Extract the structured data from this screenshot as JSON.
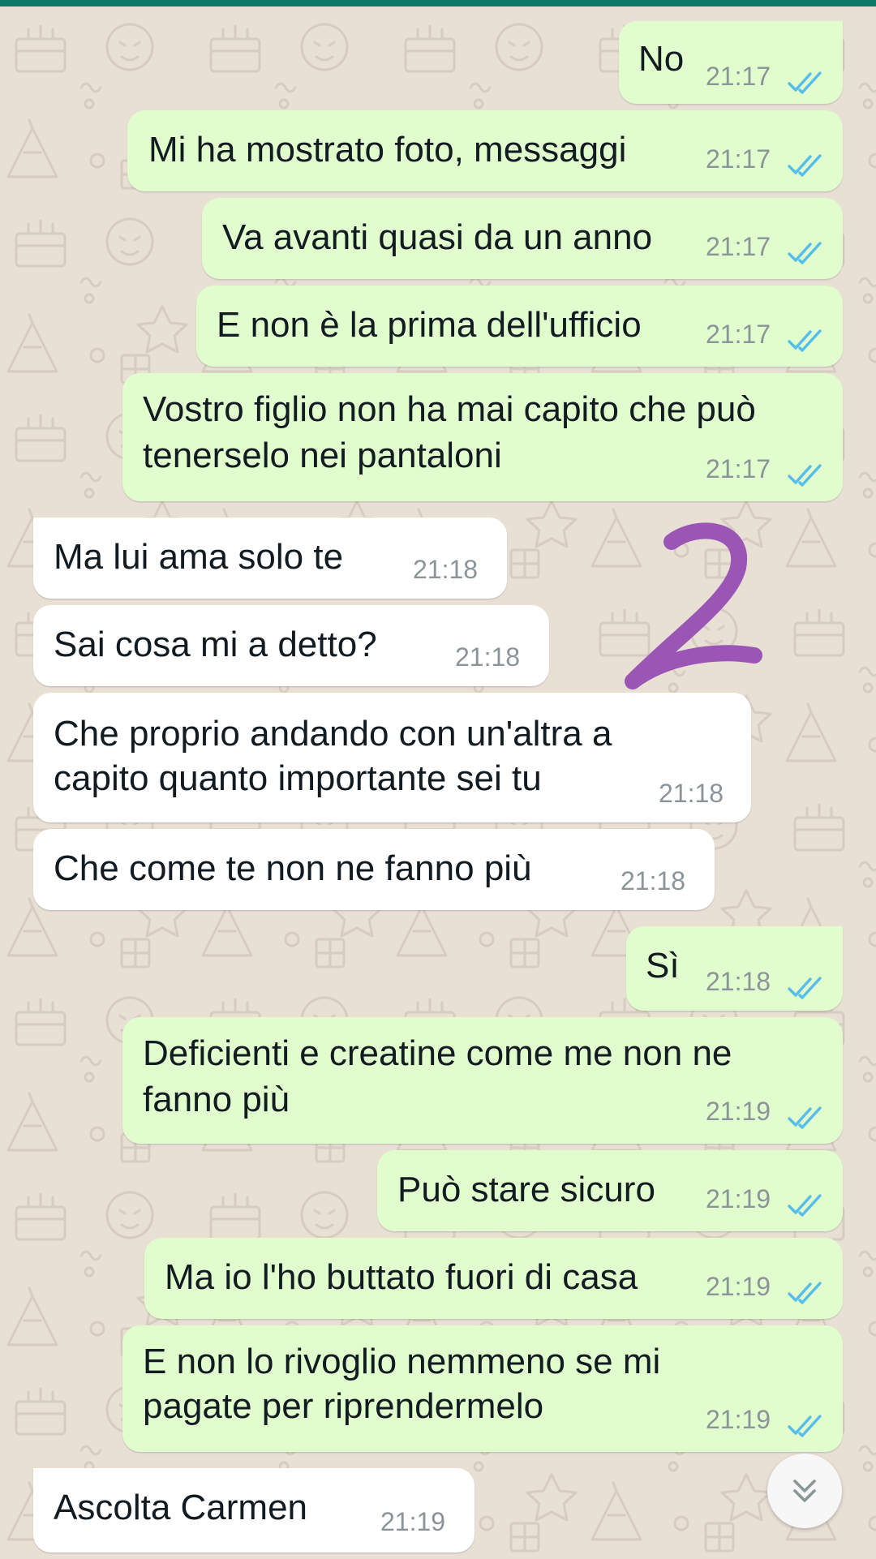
{
  "chat": {
    "messages": [
      {
        "dir": "out",
        "tail": true,
        "text": "No",
        "time": "21:17",
        "status": "read"
      },
      {
        "dir": "out",
        "tail": false,
        "text": "Mi ha mostrato foto, messaggi",
        "time": "21:17",
        "status": "read"
      },
      {
        "dir": "out",
        "tail": false,
        "text": "Va avanti quasi da un anno",
        "time": "21:17",
        "status": "read"
      },
      {
        "dir": "out",
        "tail": false,
        "text": "E non è la prima dell'ufficio",
        "time": "21:17",
        "status": "read"
      },
      {
        "dir": "out",
        "tail": false,
        "lines": [
          "Vostro figlio non ha mai capito che può",
          "tenerselo nei pantaloni"
        ],
        "time": "21:17",
        "status": "read"
      },
      {
        "dir": "in",
        "tail": true,
        "text": "Ma lui ama solo te",
        "time": "21:18"
      },
      {
        "dir": "in",
        "tail": false,
        "text": "Sai cosa mi a detto?",
        "time": "21:18"
      },
      {
        "dir": "in",
        "tail": false,
        "lines": [
          "Che proprio andando con un'altra a",
          "capito quanto importante sei tu"
        ],
        "time": "21:18"
      },
      {
        "dir": "in",
        "tail": false,
        "text": "Che come te non ne fanno più",
        "time": "21:18"
      },
      {
        "dir": "out",
        "tail": true,
        "text": "Sì",
        "time": "21:18",
        "status": "read"
      },
      {
        "dir": "out",
        "tail": false,
        "lines": [
          "Deficienti e creatine come me non ne",
          "fanno più"
        ],
        "time": "21:19",
        "status": "read"
      },
      {
        "dir": "out",
        "tail": false,
        "text": "Può stare sicuro",
        "time": "21:19",
        "status": "read"
      },
      {
        "dir": "out",
        "tail": false,
        "text": "Ma io l'ho buttato fuori di casa",
        "time": "21:19",
        "status": "read"
      },
      {
        "dir": "out",
        "tail": false,
        "lines": [
          "E non lo rivoglio nemmeno se mi",
          "pagate per riprendermelo"
        ],
        "time": "21:19",
        "status": "read"
      },
      {
        "dir": "in",
        "tail": true,
        "text": "Ascolta Carmen",
        "time": "21:19"
      }
    ]
  },
  "annotation": {
    "text": "2",
    "color": "#9b55b5"
  },
  "icons": {
    "read_receipt": "double-check-icon",
    "scroll_down": "chevron-double-down-icon"
  },
  "colors": {
    "header": "#0f7a63",
    "wallpaper": "#e8dfd5",
    "outgoing_bubble": "#e2fdcd",
    "incoming_bubble": "#ffffff",
    "read_tick": "#53bdeb",
    "timestamp": "#8a9499"
  }
}
